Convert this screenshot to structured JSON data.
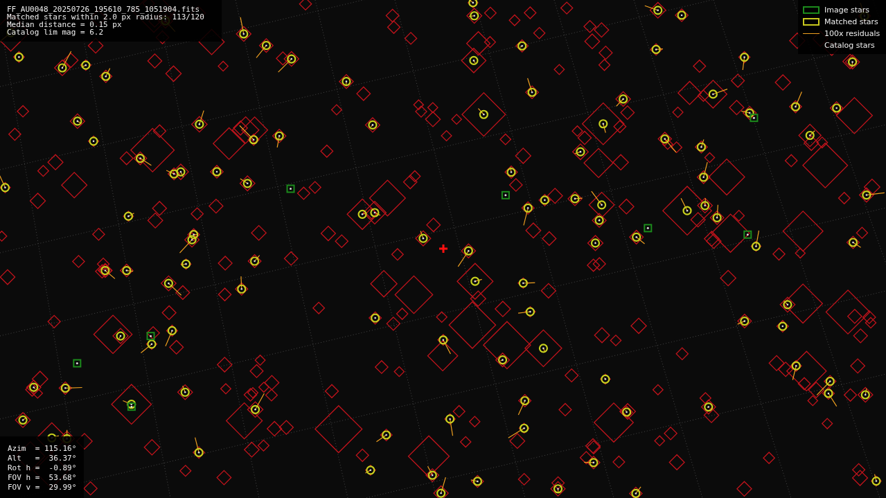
{
  "info_lines": [
    "FF_AU0048_20250726_195610_785_1051904.fits",
    "Matched stars within 2.0 px radius: 113/120",
    "Median distance = 0.15 px",
    "Catalog lim mag = 6.2"
  ],
  "legend": [
    {
      "kind": "image",
      "label": "Image stars"
    },
    {
      "kind": "matched",
      "label": "Matched stars"
    },
    {
      "kind": "residual",
      "label": "100x residuals"
    },
    {
      "kind": "catalog",
      "label": "Catalog stars"
    }
  ],
  "pointing_lines": [
    "Azim  = 115.16°",
    "Alt   =  36.37°",
    "Rot h =  -0.89°",
    "FOV h =  53.68°",
    "FOV v =  29.99°"
  ]
}
